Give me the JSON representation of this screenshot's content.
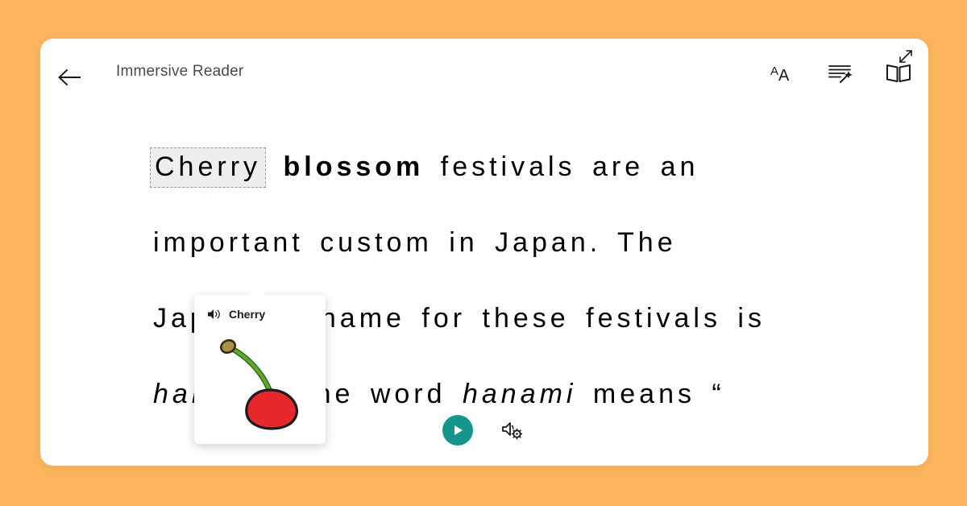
{
  "theme": {
    "page_background": "#fab45c",
    "card_background": "#ffffff",
    "play_button_color": "#15958c",
    "highlight_background": "#eeeeee",
    "cherry_color": "#e8272c",
    "stem_color": "#5a9e28"
  },
  "header": {
    "back_label": "back-arrow",
    "title": "Immersive Reader",
    "tools": [
      {
        "name": "text-preferences",
        "label": "AA"
      },
      {
        "name": "grammar-options",
        "label": "Grammar Options"
      },
      {
        "name": "reading-preferences",
        "label": "Reading Preferences"
      }
    ],
    "expand_label": "Expand"
  },
  "reader": {
    "lines": [
      {
        "id": "line1",
        "segments": [
          {
            "text": "Cherry",
            "style": "highlight"
          },
          {
            "text": " ",
            "style": "plain"
          },
          {
            "text": "blossom",
            "style": "bold"
          },
          {
            "text": " festivals are an",
            "style": "plain"
          }
        ]
      },
      {
        "id": "line2",
        "segments": [
          {
            "text": "important custom in Japan. The",
            "style": "plain"
          }
        ]
      },
      {
        "id": "line3",
        "segments": [
          {
            "text": "Japanese name for these festivals is",
            "style": "plain"
          }
        ]
      },
      {
        "id": "line4",
        "segments": [
          {
            "text": "hanami",
            "style": "italic"
          },
          {
            "text": ". The word ",
            "style": "plain"
          },
          {
            "text": "hanami",
            "style": "italic"
          },
          {
            "text": " means “",
            "style": "plain"
          }
        ]
      }
    ],
    "full_text": "Cherry blossom festivals are an important custom in Japan. The Japanese name for these festivals is hanami. The word hanami means “"
  },
  "picture_dictionary": {
    "word": "Cherry",
    "speaker_label": "Play word audio",
    "image_alt": "cherry"
  },
  "footer": {
    "play_label": "Play",
    "voice_settings_label": "Voice Settings"
  }
}
